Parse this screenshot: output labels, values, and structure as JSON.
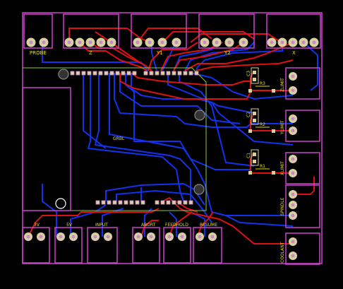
{
  "board": {
    "colors": {
      "background": "#000000",
      "outline": "#cc44cc",
      "silkscreen": "#e8e000",
      "top_copper": "#dd1111",
      "bottom_copper": "#1133ee",
      "arduino_outline": "#88cc44",
      "pad_ring": "#d8d0a0",
      "hole": "#cc88cc"
    }
  },
  "labels": {
    "probe": "PROBE",
    "z": "Z",
    "y1": "Y1",
    "y2": "Y2",
    "x": "X",
    "c3": "C3",
    "r3": "R3",
    "c2": "C2",
    "r2": "R2",
    "c1": "C1",
    "r1": "R1",
    "zlimit": "ZLIMIT",
    "ylimit": "YLIMIT",
    "xlimit": "XLIMIT",
    "spindle": "SPINDLE",
    "coolant": "COOLANT",
    "grbl": "GRBL",
    "v3": "3V",
    "v5": "5V",
    "input": "INPUT",
    "abort": "ABORT",
    "feedhold": "FEEDHOLD",
    "resume": "RESUME"
  }
}
